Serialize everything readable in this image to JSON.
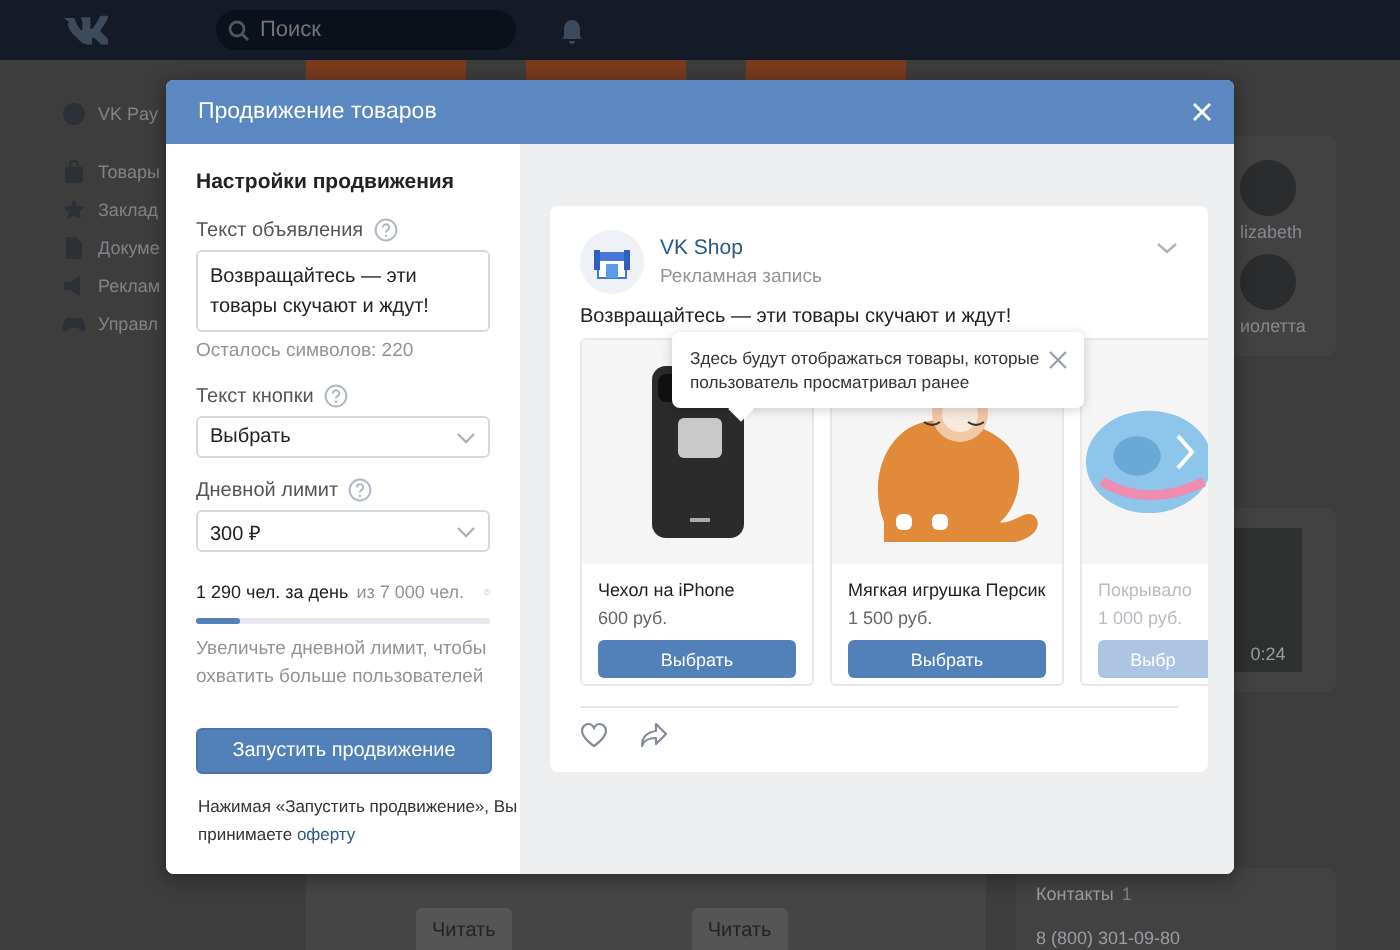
{
  "background": {
    "search": {
      "placeholder": "Поиск"
    },
    "nav": [
      {
        "kind": "pay",
        "label": "VK Pay"
      },
      {
        "kind": "bag",
        "label": "Товары"
      },
      {
        "kind": "star",
        "label": "Заклад"
      },
      {
        "kind": "doc",
        "label": "Докуме"
      },
      {
        "kind": "ads",
        "label": "Реклам"
      },
      {
        "kind": "game",
        "label": "Управл"
      }
    ],
    "feed_buttons": [
      "Читать",
      "Читать"
    ],
    "friends": [
      "lizabeth",
      "иолетта"
    ],
    "video_duration": "0:24",
    "contacts": {
      "title": "Контакты",
      "count": "1",
      "phone": "8 (800) 301-09-80"
    }
  },
  "modal": {
    "title": "Продвижение товаров",
    "settings": {
      "heading": "Настройки продвижения",
      "ad_text": {
        "label": "Текст объявления",
        "value": "Возвращайтесь — эти товары скучают и ждут!",
        "remaining": "Осталось символов: 220"
      },
      "button_text": {
        "label": "Текст кнопки",
        "value": "Выбрать"
      },
      "daily_limit": {
        "label": "Дневной лимит",
        "value": "300 ₽"
      },
      "reach": {
        "per_day": "1 290 чел. за день",
        "total": "из 7 000 чел.",
        "level": 0.15
      },
      "hint": "Увеличьте дневной лимит, чтобы охватить больше пользователей",
      "launch_button": "Запустить продвижение",
      "terms": {
        "text": "Нажимая «Запустить продвижение», Вы принимаете",
        "link": "оферту"
      }
    },
    "preview": {
      "author": "VK Shop",
      "subtitle": "Рекламная запись",
      "text": "Возвращайтесь — эти товары скучают и ждут!",
      "tooltip": "Здесь будут отображаться товары, которые пользователь просматривал ранее",
      "products": [
        {
          "kind": "phone",
          "title": "Чехол на iPhone",
          "price": "600 руб.",
          "button": "Выбрать",
          "disabled": false
        },
        {
          "kind": "cat",
          "title": "Мягкая игрушка Персик",
          "price": "1 500 руб.",
          "button": "Выбрать",
          "disabled": false
        },
        {
          "kind": "blanket",
          "title": "Покрывало",
          "price": "1 000 руб.",
          "button": "Выбр",
          "disabled": true
        }
      ]
    }
  }
}
